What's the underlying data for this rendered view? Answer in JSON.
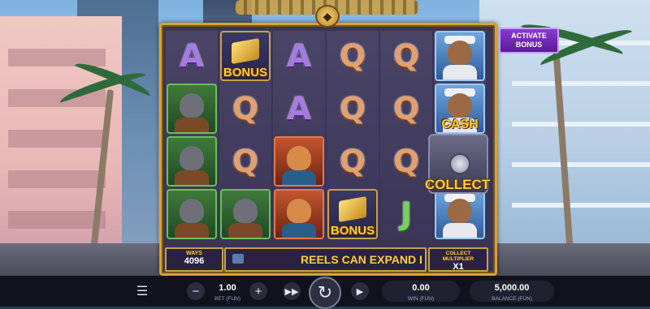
{
  "game": {
    "activate_bonus": [
      "ACTIVATE",
      "BONUS"
    ],
    "emblem_icon": "tiger-emblem-icon",
    "reels": [
      [
        "A",
        "wolf",
        "wolf",
        "wolf"
      ],
      [
        "gold-bonus",
        "Q",
        "Q",
        "wolf"
      ],
      [
        "A",
        "A",
        "puma",
        "puma"
      ],
      [
        "Q",
        "Q",
        "Q",
        "gold-bonus"
      ],
      [
        "Q",
        "Q",
        "Q",
        "J"
      ],
      [
        "bull",
        "bull-cash",
        "safe-collect",
        "bull"
      ]
    ],
    "labels": {
      "bonus": "BONUS",
      "cash": "CASH",
      "collect": "COLLECT"
    },
    "letters": {
      "A": "A",
      "Q": "Q",
      "J": "J"
    }
  },
  "info_bar": {
    "ways_title": "WAYS",
    "ways_value": "4096",
    "ticker_text": "REELS CAN EXPAND I",
    "collect_multiplier_title": "COLLECT MULTIPLIER",
    "collect_multiplier_value": "X1"
  },
  "controls": {
    "bet_value": "1.00",
    "bet_label": "BET (FUN)",
    "win_value": "0.00",
    "win_label": "WIN (FUN)",
    "balance_value": "5,000.00",
    "balance_label": "BALANCE (FUN)",
    "icons": {
      "menu": "☰",
      "minus": "−",
      "plus": "+",
      "fast_forward": "▶▶",
      "spin": "↻",
      "play": "▶"
    }
  },
  "colors": {
    "frame_gold": "#d7a23a",
    "label_gold": "#ffcf3a",
    "activate_purple": "#8a3ad0"
  }
}
